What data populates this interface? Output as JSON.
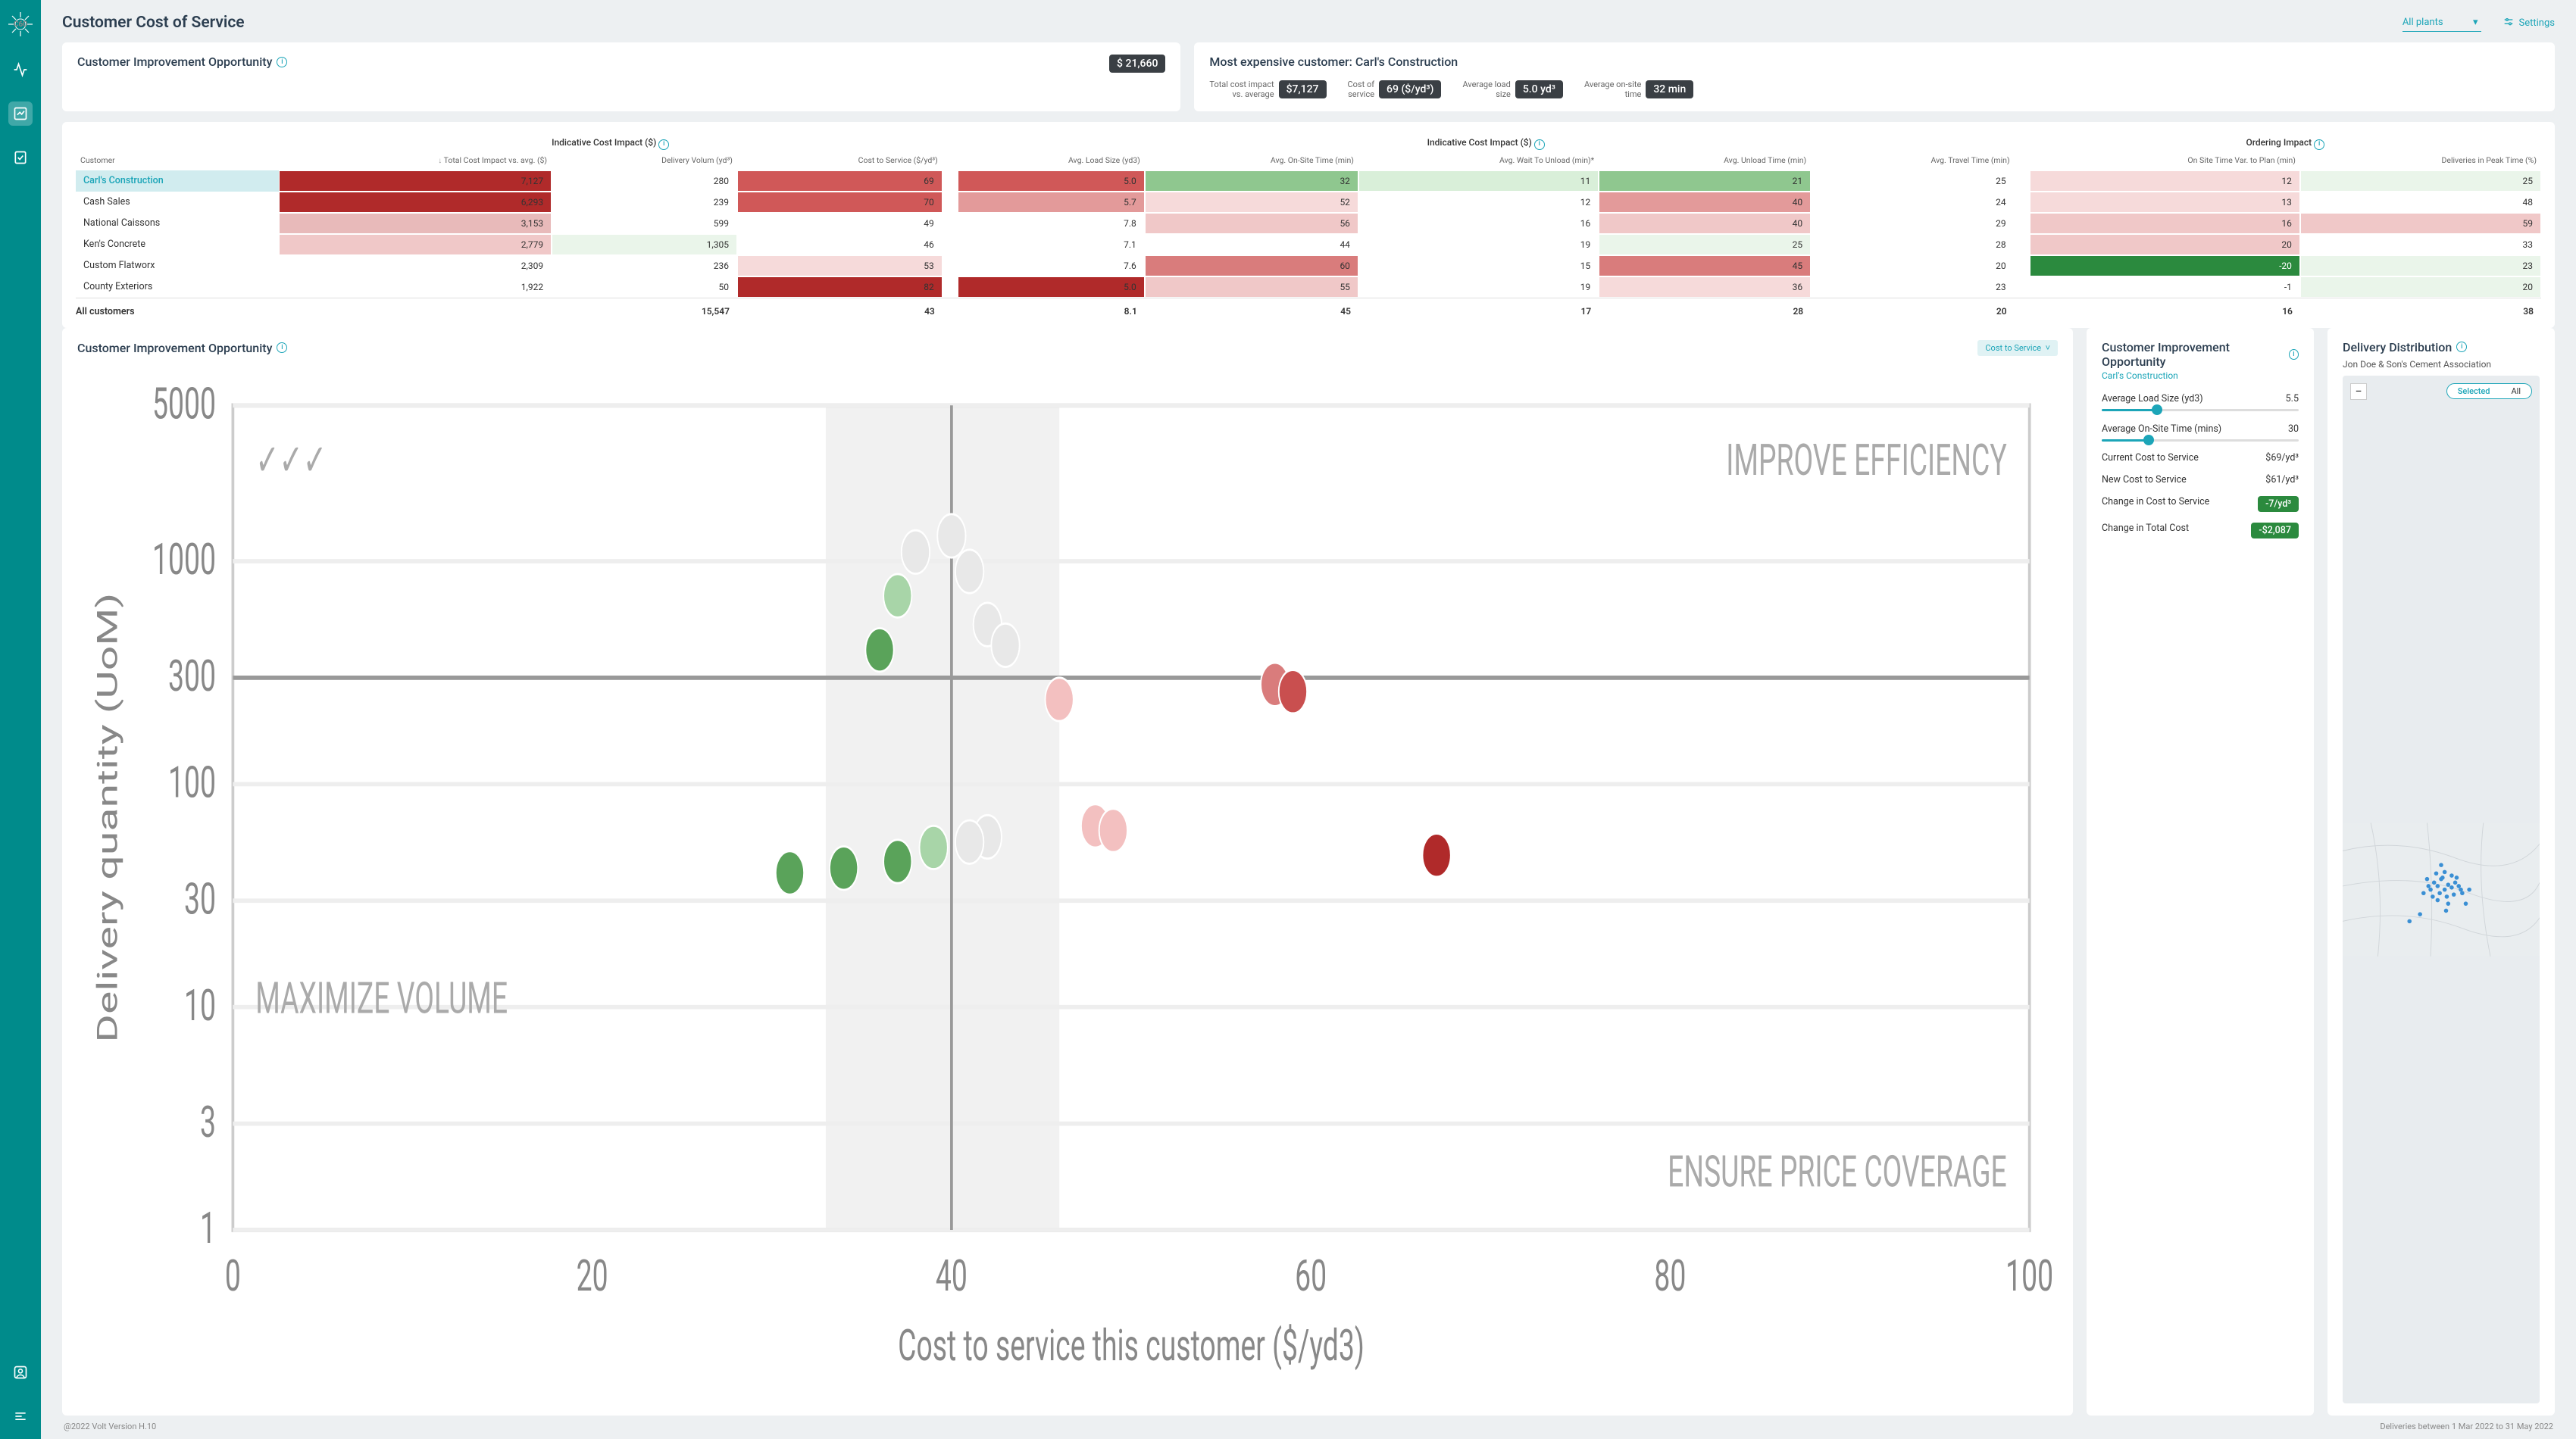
{
  "page_title": "Customer Cost of Service",
  "plant_filter": "All plants",
  "settings_label": "Settings",
  "cio_card": {
    "title": "Customer Improvement Opportunity",
    "value": "$ 21,660"
  },
  "expensive": {
    "title": "Most expensive customer: Carl's Construction",
    "stats": [
      {
        "label": "Total cost impact vs. average",
        "value": "$7,127"
      },
      {
        "label": "Cost of service",
        "value": "69 ($/yd³)"
      },
      {
        "label": "Average load size",
        "value": "5.0 yd³"
      },
      {
        "label": "Average on-site time",
        "value": "32 min"
      }
    ]
  },
  "table": {
    "groups": [
      "Indicative Cost Impact ($)",
      "Indicative Cost Impact ($)",
      "Ordering Impact"
    ],
    "cols": [
      "Customer",
      "Total Cost Impact vs. avg. ($)",
      "Delivery Volum (yd³)",
      "Cost to Service ($/yd³)",
      "Avg. Load Size (yd3)",
      "Avg. On-Site Time (min)",
      "Avg. Wait To Unload (min)*",
      "Avg. Unload Time (min)",
      "Avg. Travel Time (min)",
      "On Site Time Var. to Plan (min)",
      "Deliveries in Peak Time (%)"
    ],
    "rows": [
      {
        "name": "Carl's Construction",
        "sel": true,
        "v": [
          "7,127",
          "280",
          "69",
          "5.0",
          "32",
          "11",
          "21",
          "25",
          "12",
          "25"
        ],
        "c": [
          "#b02a2a",
          "#fff",
          "#d05858",
          "#d05858",
          "#8fc78f",
          "#d9efd9",
          "#8fc78f",
          "#fff",
          "#f6dada",
          "#eaf5ea"
        ]
      },
      {
        "name": "Cash Sales",
        "v": [
          "6,293",
          "239",
          "70",
          "5.7",
          "52",
          "12",
          "40",
          "24",
          "13",
          "48"
        ],
        "c": [
          "#b02a2a",
          "#fff",
          "#d05858",
          "#e39a9a",
          "#f6dada",
          "#fff",
          "#e39a9a",
          "#fff",
          "#f6dada",
          "#fff"
        ]
      },
      {
        "name": "National Caissons",
        "v": [
          "3,153",
          "599",
          "49",
          "7.8",
          "56",
          "16",
          "40",
          "29",
          "16",
          "59"
        ],
        "c": [
          "#e8baba",
          "#fff",
          "#fff",
          "#fff",
          "#f0c8c8",
          "#fff",
          "#f0c8c8",
          "#fff",
          "#f0c8c8",
          "#f0c8c8"
        ]
      },
      {
        "name": "Ken's Concrete",
        "v": [
          "2,779",
          "1,305",
          "46",
          "7.1",
          "44",
          "19",
          "25",
          "28",
          "20",
          "33"
        ],
        "c": [
          "#f0c8c8",
          "#eaf5ea",
          "#fff",
          "#fff",
          "#fff",
          "#fff",
          "#eaf5ea",
          "#fff",
          "#f0c8c8",
          "#fff"
        ]
      },
      {
        "name": "Custom Flatworx",
        "v": [
          "2,309",
          "236",
          "53",
          "7.6",
          "60",
          "15",
          "45",
          "20",
          "-20",
          "23"
        ],
        "c": [
          "#fff",
          "#fff",
          "#f6dada",
          "#fff",
          "#d97c7c",
          "#fff",
          "#d97c7c",
          "#fff",
          "#2b8a3e",
          "#eaf5ea"
        ]
      },
      {
        "name": "County Exteriors",
        "v": [
          "1,922",
          "50",
          "82",
          "5.0",
          "55",
          "19",
          "36",
          "23",
          "-1",
          "20"
        ],
        "c": [
          "#fff",
          "#fff",
          "#b02a2a",
          "#b02a2a",
          "#f0c8c8",
          "#fff",
          "#f6dada",
          "#fff",
          "#fff",
          "#eaf5ea"
        ]
      }
    ],
    "total": {
      "name": "All customers",
      "v": [
        "",
        "15,547",
        "43",
        "8.1",
        "45",
        "17",
        "28",
        "20",
        "16",
        "38"
      ]
    }
  },
  "scatter": {
    "title": "Customer Improvement Opportunity",
    "dropdown": "Cost to Service",
    "xlabel": "Cost to service this customer ($/yd3)",
    "ylabel": "Delivery quantity (UoM)",
    "quads": [
      "IMPROVE EFFICIENCY",
      "ENSURE PRICE COVERAGE",
      "MAXIMIZE VOLUME"
    ]
  },
  "opp": {
    "title": "Customer Improvement Opportunity",
    "customer": "Carl's Construction",
    "load": {
      "label": "Average Load Size (yd3)",
      "value": "5.5",
      "pct": 28
    },
    "onsite": {
      "label": "Average On-Site Time (mins)",
      "value": "30",
      "pct": 24
    },
    "results": [
      {
        "label": "Current Cost to Service",
        "value": "$69/yd³"
      },
      {
        "label": "New Cost to Service",
        "value": "$61/yd³"
      },
      {
        "label": "Change in Cost to Service",
        "value": "-7/yd³",
        "green": true
      },
      {
        "label": "Change in Total Cost",
        "value": "-$2,087",
        "green": true
      }
    ]
  },
  "map": {
    "title": "Delivery Distribution",
    "sub": "Jon Doe & Son's Cement Association",
    "selected": "Selected",
    "all": "All"
  },
  "footer": {
    "left": "@2022 Volt  Version H.10",
    "right": "Deliveries between 1 Mar 2022 to 31 May 2022"
  },
  "chart_data": {
    "type": "scatter",
    "xlabel": "Cost to service this customer ($/yd3)",
    "ylabel": "Delivery quantity (UoM)",
    "xlim": [
      0,
      100
    ],
    "ylim": [
      1,
      5000
    ],
    "yscale": "log",
    "xticks": [
      0,
      20,
      40,
      60,
      80,
      100
    ],
    "yticks": [
      1,
      3,
      10,
      30,
      100,
      300,
      1000,
      5000
    ],
    "band": [
      33,
      46
    ],
    "points": [
      {
        "x": 36,
        "y": 400,
        "c": "#5aa35a"
      },
      {
        "x": 37,
        "y": 700,
        "c": "#a8d5a8"
      },
      {
        "x": 38,
        "y": 1100,
        "c": "#e8e8e8"
      },
      {
        "x": 40,
        "y": 1300,
        "c": "#e8e8e8"
      },
      {
        "x": 41,
        "y": 900,
        "c": "#e8e8e8"
      },
      {
        "x": 42,
        "y": 520,
        "c": "#e8e8e8"
      },
      {
        "x": 43,
        "y": 420,
        "c": "#e8e8e8"
      },
      {
        "x": 46,
        "y": 240,
        "c": "#f3c0c0"
      },
      {
        "x": 48,
        "y": 65,
        "c": "#f3c0c0"
      },
      {
        "x": 49,
        "y": 62,
        "c": "#f3c0c0"
      },
      {
        "x": 42,
        "y": 58,
        "c": "#e8e8e8"
      },
      {
        "x": 41,
        "y": 55,
        "c": "#e8e8e8"
      },
      {
        "x": 39,
        "y": 52,
        "c": "#a8d5a8"
      },
      {
        "x": 37,
        "y": 45,
        "c": "#5aa35a"
      },
      {
        "x": 34,
        "y": 42,
        "c": "#5aa35a"
      },
      {
        "x": 31,
        "y": 40,
        "c": "#5aa35a"
      },
      {
        "x": 58,
        "y": 280,
        "c": "#d97c7c"
      },
      {
        "x": 59,
        "y": 260,
        "c": "#c94f4f"
      },
      {
        "x": 67,
        "y": 48,
        "c": "#b02a2a"
      }
    ]
  }
}
